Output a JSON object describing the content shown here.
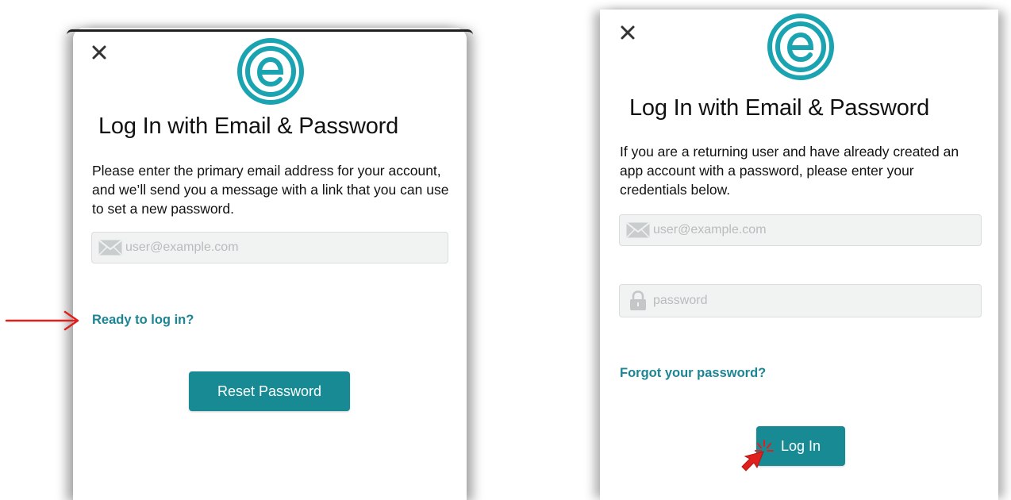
{
  "theme": {
    "brand_color": "#178a93",
    "link_color": "#1c8593",
    "annotation_color": "#e0201c",
    "field_bg": "#f1f3f3"
  },
  "icons": {
    "close": "close-icon",
    "logo": "e-logo-icon",
    "email": "envelope-icon",
    "password": "lock-icon",
    "arrow": "red-arrow-icon",
    "pointer": "click-pointer-icon"
  },
  "reset_screen": {
    "title": "Log In with Email & Password",
    "description": "Please enter the primary email address for your account, and we’ll send you a message with a link that you can use to set a new password.",
    "email_placeholder": "user@example.com",
    "login_link": "Ready to log in?",
    "reset_button": "Reset Password"
  },
  "login_screen": {
    "title": "Log In with Email & Password",
    "description": "If you are a returning user and have already created an app account with a password, please enter your credentials below.",
    "email_placeholder": "user@example.com",
    "password_placeholder": "password",
    "forgot_link": "Forgot your password?",
    "login_button": "Log In"
  }
}
